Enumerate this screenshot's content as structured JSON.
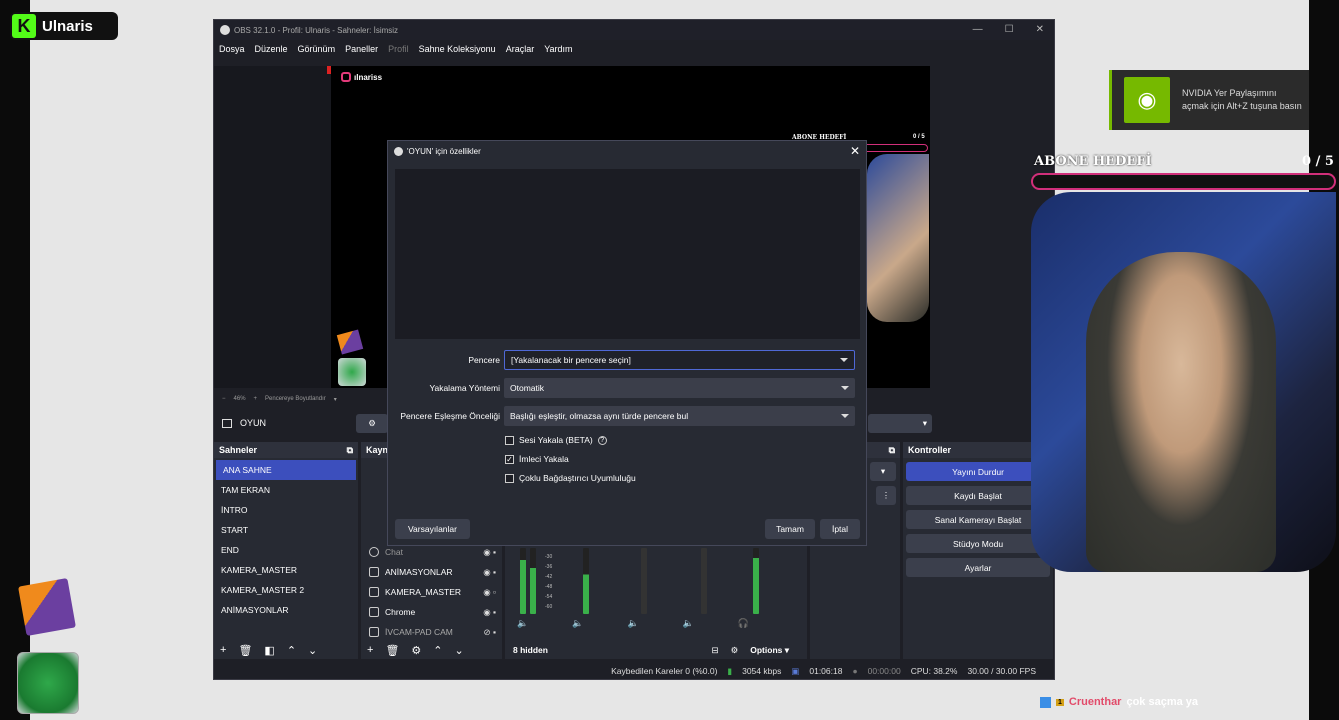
{
  "overlay": {
    "brand_letter": "K",
    "brand_name": "Ulnaris",
    "nvidia_text": "NVIDIA Yer Paylaşımını açmak için Alt+Z tuşuna basın",
    "goal_title": "ABONE HEDEFİ",
    "goal_count": "0 / 5",
    "chat": {
      "badge": "1",
      "user": "Cruenthar",
      "message": "çok saçma ya"
    }
  },
  "obs": {
    "title": "OBS 32.1.0 - Profil: Ulnaris - Sahneler: İsimsiz",
    "menu": [
      "Dosya",
      "Düzenle",
      "Görünüm",
      "Paneller",
      "Profil",
      "Sahne Koleksiyonu",
      "Araçlar",
      "Yardım"
    ],
    "preview_handle": "ılnariss",
    "preview_goal": "ABONE HEDEFİ",
    "preview_goal_count": "0 / 5",
    "zoom": "46%",
    "zoom_fit": "Pencereye Boyutlandır",
    "selected_source": "OYUN",
    "scenes_title": "Sahneler",
    "scenes": [
      "ANA SAHNE",
      "TAM EKRAN",
      "İNTRO",
      "START",
      "END",
      "KAMERA_MASTER",
      "KAMERA_MASTER 2",
      "ANİMASYONLAR"
    ],
    "sources_title": "Kaynaklar",
    "sources": [
      "Chat",
      "ANİMASYONLAR",
      "KAMERA_MASTER",
      "Chrome",
      "İVCAM-PAD CAM"
    ],
    "meter_labels": [
      "-30",
      "-36",
      "-42",
      "-48",
      "-54",
      "-60"
    ],
    "mixer_hidden": "8 hidden",
    "options_label": "Options",
    "controls_title": "Kontroller",
    "controls": [
      "Yayını Durdur",
      "Kaydı Başlat",
      "Sanal Kamerayı Başlat",
      "Stüdyo Modu",
      "Ayarlar"
    ],
    "status": {
      "dropped": "Kaybedilen Kareler 0 (%0.0)",
      "bitrate": "3054 kbps",
      "live_time": "01:06:18",
      "rec_time": "00:00:00",
      "cpu": "CPU: 38.2%",
      "fps": "30.00 / 30.00 FPS"
    }
  },
  "dialog": {
    "title": "'OYUN' için özellikler",
    "window_label": "Pencere",
    "window_value": "[Yakalanacak bir pencere seçin]",
    "method_label": "Yakalama Yöntemi",
    "method_value": "Otomatik",
    "priority_label": "Pencere Eşleşme Önceliği",
    "priority_value": "Başlığı eşleştir, olmazsa aynı türde pencere bul",
    "check_audio": "Sesi Yakala (BETA)",
    "check_cursor": "İmleci Yakala",
    "check_multi": "Çoklu Bağdaştırıcı Uyumluluğu",
    "defaults": "Varsayılanlar",
    "ok": "Tamam",
    "cancel": "İptal"
  }
}
